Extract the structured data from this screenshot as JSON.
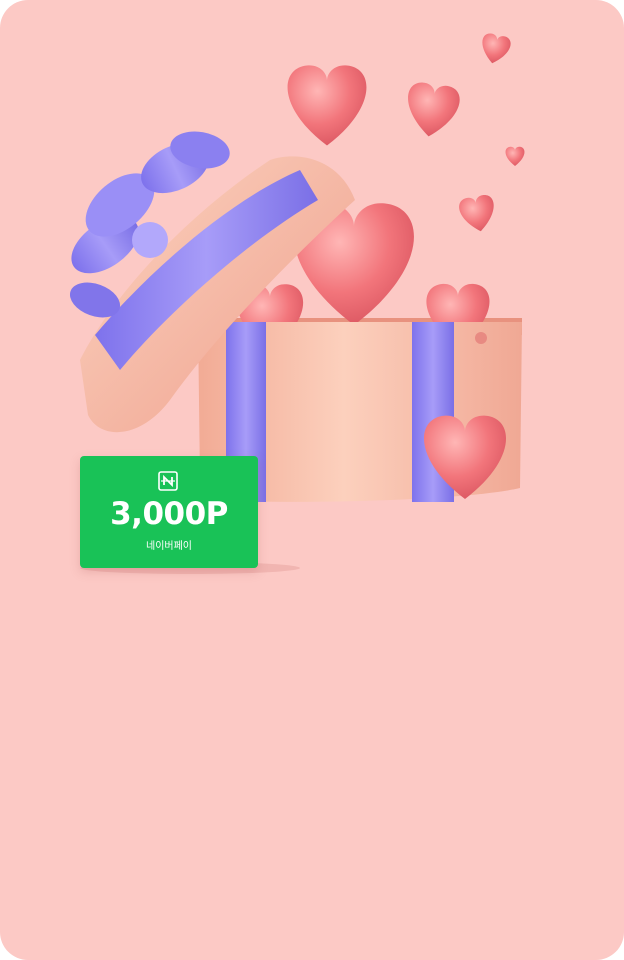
{
  "colors": {
    "background": "#fcc9c5",
    "card_green": "#19c257",
    "heart": "#f2757b",
    "box": "#f7b9a3",
    "ribbon": "#8a80f0"
  },
  "reward_card": {
    "logo_icon": "naver-pay-n-icon",
    "amount": "3,000P",
    "brand": "네이버페이"
  }
}
